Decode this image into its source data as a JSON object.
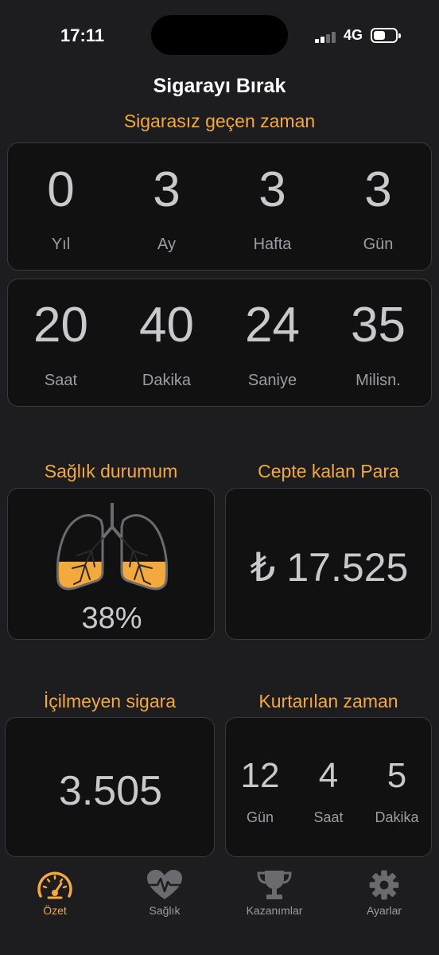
{
  "status": {
    "time": "17:11",
    "network": "4G"
  },
  "app_title": "Sigarayı Bırak",
  "smoke_free": {
    "title": "Sigarasız geçen zaman",
    "row1": [
      {
        "value": "0",
        "unit": "Yıl"
      },
      {
        "value": "3",
        "unit": "Ay"
      },
      {
        "value": "3",
        "unit": "Hafta"
      },
      {
        "value": "3",
        "unit": "Gün"
      }
    ],
    "row2": [
      {
        "value": "20",
        "unit": "Saat"
      },
      {
        "value": "40",
        "unit": "Dakika"
      },
      {
        "value": "24",
        "unit": "Saniye"
      },
      {
        "value": "35",
        "unit": "Milisn."
      }
    ]
  },
  "health": {
    "title": "Sağlık durumum",
    "percent": "38%",
    "fill_fraction": 0.38
  },
  "money": {
    "title": "Cepte kalan Para",
    "value": "₺ 17.525"
  },
  "cigarettes": {
    "title": "İçilmeyen sigara",
    "value": "3.505"
  },
  "saved_time": {
    "title": "Kurtarılan zaman",
    "items": [
      {
        "value": "12",
        "unit": "Gün"
      },
      {
        "value": "4",
        "unit": "Saat"
      },
      {
        "value": "5",
        "unit": "Dakika"
      }
    ]
  },
  "tabs": [
    {
      "label": "Özet",
      "icon": "speedometer-icon",
      "active": true
    },
    {
      "label": "Sağlık",
      "icon": "heart-pulse-icon",
      "active": false
    },
    {
      "label": "Kazanımlar",
      "icon": "trophy-icon",
      "active": false
    },
    {
      "label": "Ayarlar",
      "icon": "gear-icon",
      "active": false
    }
  ],
  "colors": {
    "accent": "#f3a93b",
    "background": "#1d1d1f",
    "card": "#111112"
  }
}
